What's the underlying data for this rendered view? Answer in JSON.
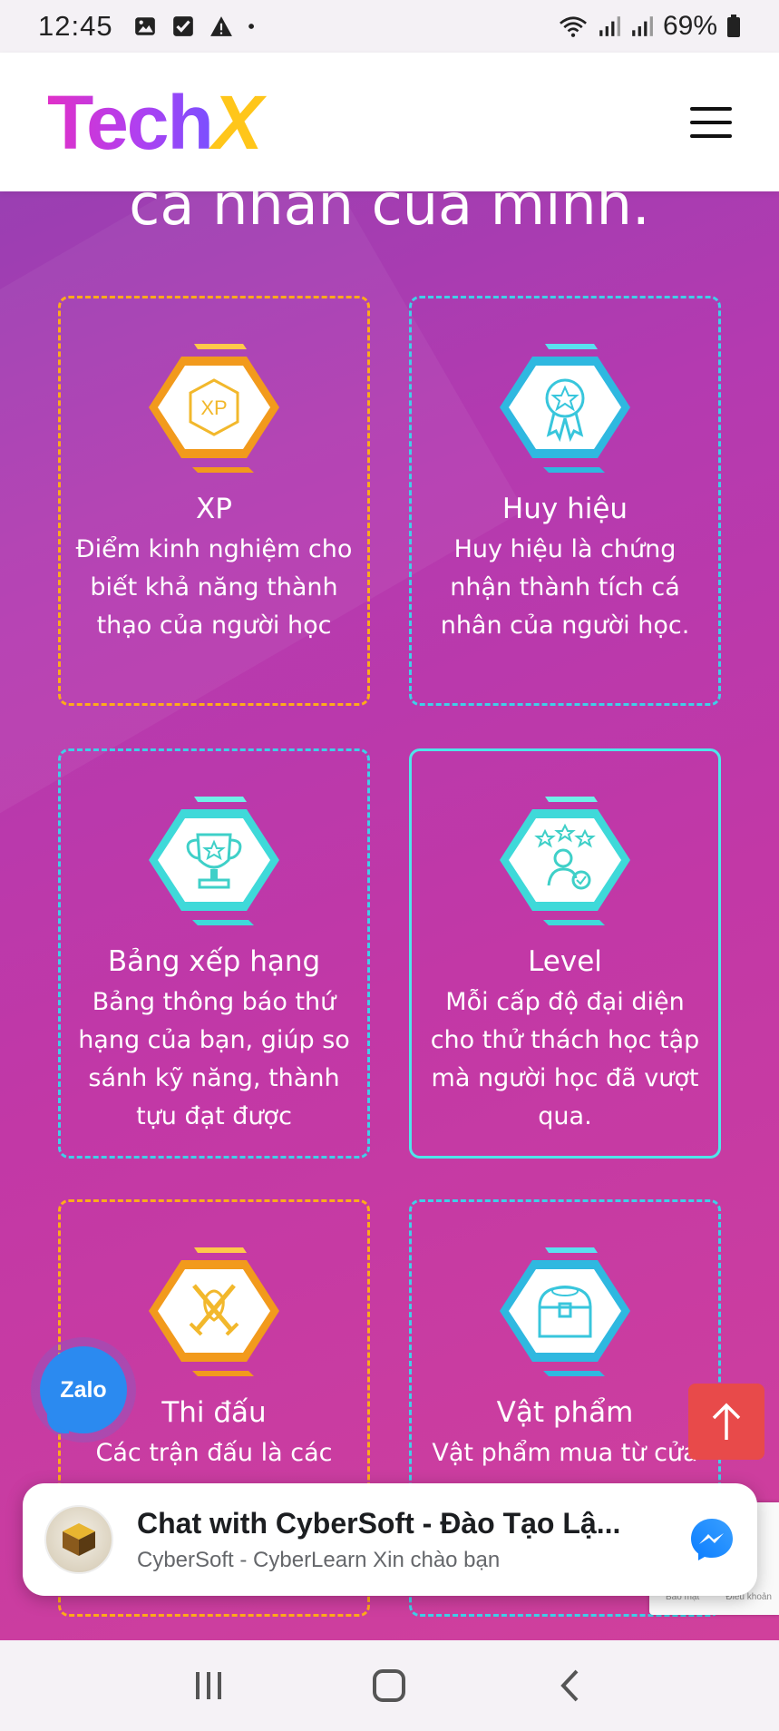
{
  "status_bar": {
    "time": "12:45",
    "battery": "69%",
    "icons_left": [
      "image-icon",
      "checkbox-icon",
      "warning-icon",
      "dot-icon"
    ],
    "icons_right": [
      "wifi-icon",
      "signal-icon",
      "signal-icon",
      "battery-icon"
    ]
  },
  "header": {
    "logo_part1": "Tech",
    "logo_part2": "X"
  },
  "main": {
    "heading_partial": "ca nhan của mình.",
    "cards": [
      {
        "title": "XP",
        "desc": "Điểm kinh nghiệm cho biết khả năng thành thạo của người học",
        "color": "#ffab1a",
        "icon": "xp-badge-icon"
      },
      {
        "title": "Huy hiệu",
        "desc": "Huy hiệu là chứng nhận thành tích cá nhân của người học.",
        "color": "#3fd0e8",
        "icon": "medal-badge-icon"
      },
      {
        "title": "Bảng xếp hạng",
        "desc": "Bảng thông báo thứ hạng của bạn, giúp so sánh kỹ năng, thành tựu đạt được",
        "color": "#3fd0e8",
        "icon": "trophy-badge-icon"
      },
      {
        "title": "Level",
        "desc": "Mỗi cấp độ đại diện cho thử thách học tập mà người học đã vượt qua.",
        "color": "#4ee6ea",
        "icon": "level-badge-icon"
      },
      {
        "title": "Thi đấu",
        "desc": "Các trận đấu là các",
        "color": "#ffab1a",
        "icon": "swords-badge-icon"
      },
      {
        "title": "Vật phẩm",
        "desc": "Vật phẩm mua từ cửa",
        "color": "#3fd0e8",
        "icon": "chest-badge-icon"
      }
    ]
  },
  "zalo": {
    "label": "Zalo"
  },
  "chat": {
    "title": "Chat with CyberSoft - Đào Tạo Lậ...",
    "subtitle": "CyberSoft - CyberLearn Xin chào bạn"
  },
  "recaptcha": {
    "privacy": "Bảo mật",
    "terms": "Điều khoản"
  },
  "colors": {
    "accent_orange": "#ffab1a",
    "accent_cyan": "#3fd0e8",
    "scroll_top": "#e84a4a",
    "zalo": "#2b8af0"
  }
}
